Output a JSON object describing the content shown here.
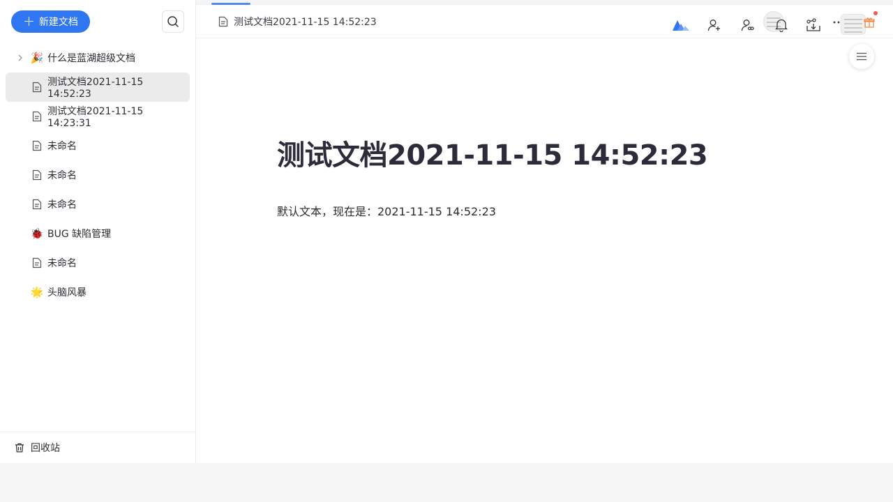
{
  "sidebar": {
    "new_doc_label": "新建文档",
    "items": [
      {
        "label": "什么是蓝湖超级文档",
        "icon": "party-popper-icon",
        "glyph": "🎉",
        "expandable": true,
        "active": false
      },
      {
        "label": "测试文档2021-11-15 14:52:23",
        "icon": "document-icon",
        "active": true
      },
      {
        "label": "测试文档2021-11-15 14:23:31",
        "icon": "document-icon",
        "active": false
      },
      {
        "label": "未命名",
        "icon": "document-icon",
        "active": false
      },
      {
        "label": "未命名",
        "icon": "document-icon",
        "active": false
      },
      {
        "label": "未命名",
        "icon": "document-icon",
        "active": false
      },
      {
        "label": "BUG 缺陷管理",
        "icon": "ladybug-icon",
        "glyph": "🐞",
        "active": false
      },
      {
        "label": "未命名",
        "icon": "document-icon",
        "active": false
      },
      {
        "label": "头脑风暴",
        "icon": "sparkle-icon",
        "glyph": "🌟",
        "active": false
      }
    ],
    "trash_label": "回收站"
  },
  "header": {
    "breadcrumb": "测试文档2021-11-15 14:52:23"
  },
  "document": {
    "title": "测试文档2021-11-15 14:52:23",
    "body": "默认文本，现在是：2021-11-15 14:52:23"
  },
  "colors": {
    "accent": "#2f76f2",
    "active_row": "#ebebeb",
    "notification_dot": "#f25c54"
  }
}
